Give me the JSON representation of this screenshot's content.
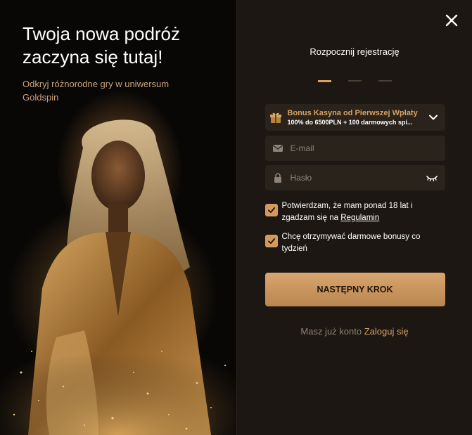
{
  "promo": {
    "title_line1": "Twoja nowa podróż",
    "title_line2": "zaczyna się tutaj!",
    "subtitle": "Odkryj różnorodne gry w uniwersum Goldspin"
  },
  "form": {
    "title": "Rozpocznij rejestrację",
    "steps": {
      "total": 3,
      "active": 1
    },
    "bonus": {
      "title": "Bonus Kasyna od Pierwszej Wpłaty",
      "description": "100% do 6500PLN + 100 darmowych spi..."
    },
    "email": {
      "placeholder": "E-mail",
      "value": ""
    },
    "password": {
      "placeholder": "Hasło",
      "value": ""
    },
    "consent_age": {
      "text": "Potwierdzam, że mam ponad 18 lat i zgadzam się na ",
      "link": "Regulamin",
      "checked": true
    },
    "consent_bonus": {
      "text": "Chcę otrzymywać darmowe bonusy co tydzień",
      "checked": true
    },
    "next_button": "NASTĘPNY KROK",
    "login_prompt": "Masz już konto",
    "login_link": "Zaloguj się"
  },
  "icons": {
    "close": "close-icon",
    "gift": "gift-icon",
    "chevron": "chevron-down-icon",
    "email": "envelope-icon",
    "password": "lock-icon",
    "eye": "eye-closed-icon",
    "check": "checkmark-icon"
  },
  "colors": {
    "accent": "#d8a064",
    "panel": "#1c1712",
    "field": "#2a231c",
    "muted": "#8d8276"
  }
}
